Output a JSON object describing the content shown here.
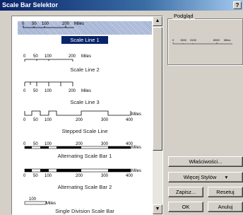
{
  "window": {
    "title": "Scale Bar Selektor",
    "help_label": "?"
  },
  "styles": [
    {
      "label": "Scale Line 1",
      "ticks": [
        "0",
        "50",
        "100",
        "200",
        "Miles"
      ]
    },
    {
      "label": "Scale Line 2",
      "ticks": [
        "0",
        "50",
        "100",
        "200",
        "Miles"
      ]
    },
    {
      "label": "Scale Line 3",
      "ticks": [
        "0",
        "50",
        "100",
        "200",
        "Miles"
      ]
    },
    {
      "label": "Stepped Scale Line",
      "ticks": [
        "0",
        "50",
        "100",
        "200",
        "300",
        "400",
        "Miles"
      ]
    },
    {
      "label": "Alternating Scale Bar 1",
      "ticks": [
        "0",
        "50",
        "100",
        "200",
        "300",
        "400",
        "Miles"
      ]
    },
    {
      "label": "Alternating Scale Bar 2",
      "ticks": [
        "0",
        "50",
        "100",
        "200",
        "300",
        "400",
        "Miles"
      ]
    },
    {
      "label": "Single Division Scale Bar",
      "ticks": [
        "100",
        "Miles"
      ]
    }
  ],
  "preview": {
    "label": "Podgląd",
    "ticks": [
      "0",
      "1500",
      "3100",
      "6500",
      "Miles"
    ]
  },
  "buttons": {
    "properties": "Właściwości...",
    "more_styles": "Więcej Stylów",
    "save": "Zapisz...",
    "reset": "Resetuj",
    "ok": "OK",
    "cancel": "Anuluj"
  },
  "icons": {
    "dropdown": "▾",
    "scroll_up": "▲",
    "scroll_down": "▼"
  }
}
